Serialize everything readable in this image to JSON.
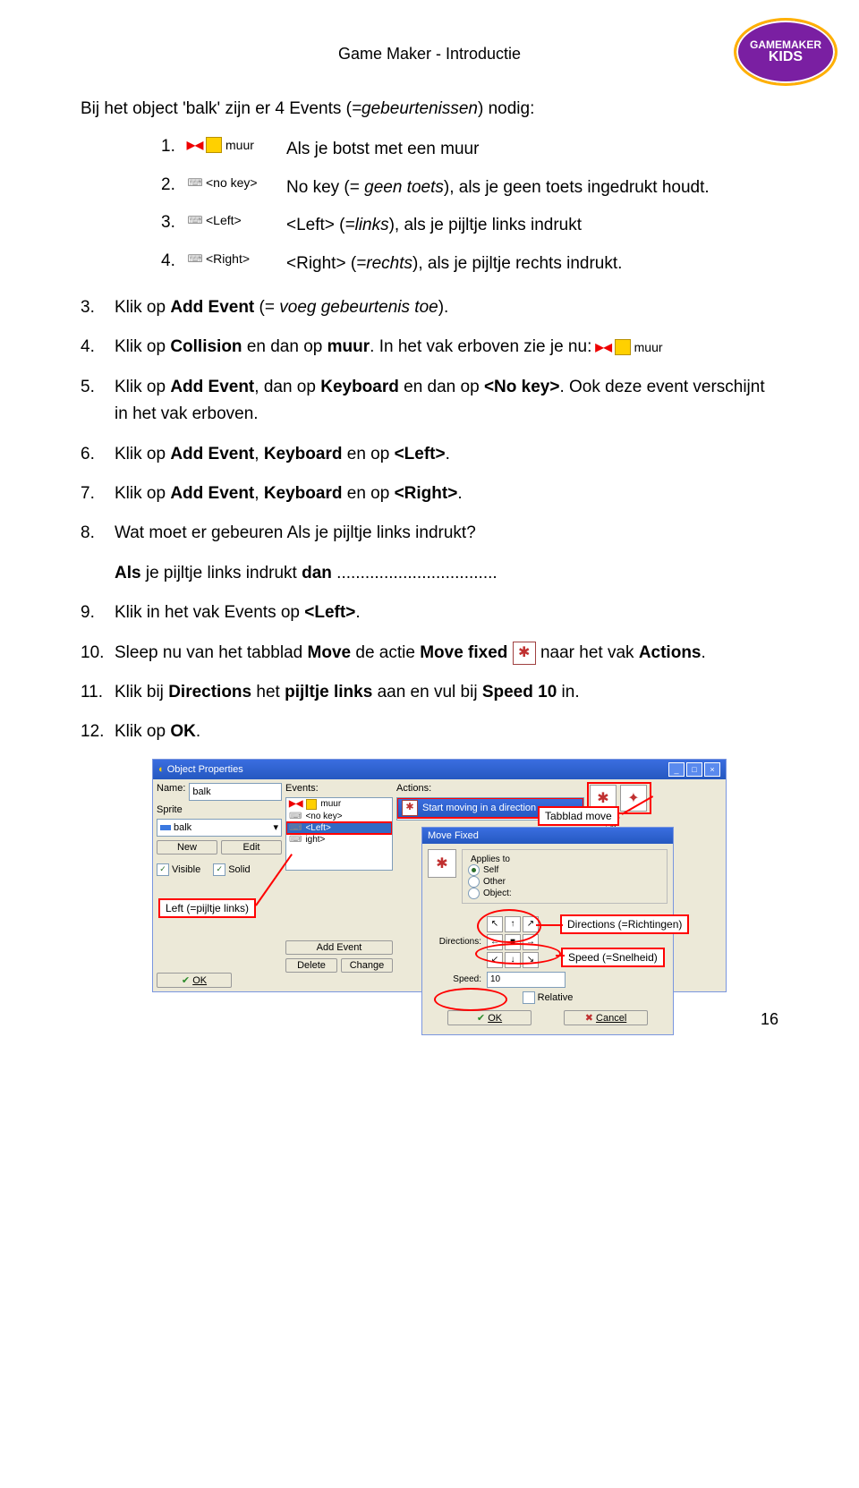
{
  "header": {
    "title": "Game Maker - Introductie"
  },
  "logo": {
    "line1": "GAMEMAKER",
    "line2": "KIDS"
  },
  "intro": {
    "prefix": "Bij het object 'balk' zijn er 4 Events (",
    "italic": "=gebeurtenissen",
    "suffix": ") nodig:"
  },
  "events": {
    "e1": {
      "num": "1.",
      "icon_label": "muur",
      "text": "Als je botst met een muur"
    },
    "e2": {
      "num": "2.",
      "icon_label": "<no key>",
      "pre": "No key (= ",
      "italic": "geen toets",
      "post": "), als je geen toets ingedrukt houdt."
    },
    "e3": {
      "num": "3.",
      "icon_label": "<Left>",
      "pre": "<Left> (",
      "italic": "=links",
      "post": "), als je pijltje links indrukt"
    },
    "e4": {
      "num": "4.",
      "icon_label": "<Right>",
      "pre": "<Right> (",
      "italic": "=rechts",
      "post": "), als je pijltje rechts indrukt."
    }
  },
  "steps": {
    "s3": {
      "num": "3.",
      "p1": "Klik op ",
      "b1": "Add Event",
      "p2": " (= ",
      "i1": "voeg gebeurtenis toe",
      "p3": ")."
    },
    "s4": {
      "num": "4.",
      "p1": "Klik op ",
      "b1": "Collision",
      "p2": " en dan op ",
      "b2": "muur",
      "p3": ". In het vak erboven zie je nu:",
      "icon_label": "muur"
    },
    "s5": {
      "num": "5.",
      "p1": "Klik op ",
      "b1": "Add Event",
      "p2": ", dan op ",
      "b2": "Keyboard",
      "p3": " en dan op ",
      "b3": "<No key>",
      "p4": ". Ook deze event verschijnt in het vak erboven."
    },
    "s6": {
      "num": "6.",
      "p1": "Klik op ",
      "b1": "Add Event",
      "p2": ", ",
      "b2": "Keyboard",
      "p3": " en op ",
      "b3": "<Left>",
      "p4": "."
    },
    "s7": {
      "num": "7.",
      "p1": "Klik op ",
      "b1": "Add Event",
      "p2": ", ",
      "b2": "Keyboard",
      "p3": " en op ",
      "b3": "<Right>",
      "p4": "."
    },
    "s8": {
      "num": "8.",
      "text": "Wat moet er gebeuren Als je pijltje links indrukt?"
    },
    "fill": {
      "b1": "Als",
      "p1": " je pijltje links indrukt ",
      "b2": "dan",
      "dots": "  .................................."
    },
    "s9": {
      "num": "9.",
      "p1": "Klik in het vak Events op ",
      "b1": "<Left>",
      "p2": "."
    },
    "s10": {
      "num": "10.",
      "p1": "Sleep nu van het tabblad ",
      "b1": "Move",
      "p2": " de actie ",
      "b2": "Move fixed",
      "p3": " naar het vak ",
      "b3": "Actions",
      "p4": "."
    },
    "s11": {
      "num": "11.",
      "p1": "Klik bij ",
      "b1": "Directions",
      "p2": " het ",
      "b2": "pijltje links",
      "p3": " aan en vul bij ",
      "b3": "Speed 10",
      "p4": " in."
    },
    "s12": {
      "num": "12.",
      "p1": "Klik op ",
      "b1": "OK",
      "p2": "."
    }
  },
  "screenshot": {
    "window_title": "Object Properties",
    "left": {
      "name_label": "Name:",
      "name_value": "balk",
      "sprite_label": "Sprite",
      "sprite_value": "balk",
      "new_btn": "New",
      "edit_btn": "Edit",
      "visible": "Visible",
      "solid": "Solid",
      "ok_btn": "OK"
    },
    "events": {
      "label": "Events:",
      "items": {
        "muur": "muur",
        "nokey": "<no key>",
        "left": "<Left>",
        "right": "ight>"
      },
      "add_event_btn": "Add Event",
      "delete_btn": "Delete",
      "change_btn": "Change"
    },
    "actions": {
      "label": "Actions:",
      "action1": "Start moving in a direction"
    },
    "right": {
      "tab_move": "Move"
    },
    "callouts": {
      "tabblad_move": "Tabblad move",
      "left_pijltje": "Left (=pijltje links)",
      "directions": "Directions (=Richtingen)",
      "speed": "Speed (=Snelheid)"
    },
    "move_fixed": {
      "title": "Move Fixed",
      "applies_to": "Applies to",
      "self": "Self",
      "other": "Other",
      "object": "Object:",
      "directions_label": "Directions:",
      "speed_label": "Speed:",
      "speed_value": "10",
      "relative": "Relative",
      "ok_btn": "OK",
      "cancel_btn": "Cancel"
    }
  },
  "page_number": "16"
}
